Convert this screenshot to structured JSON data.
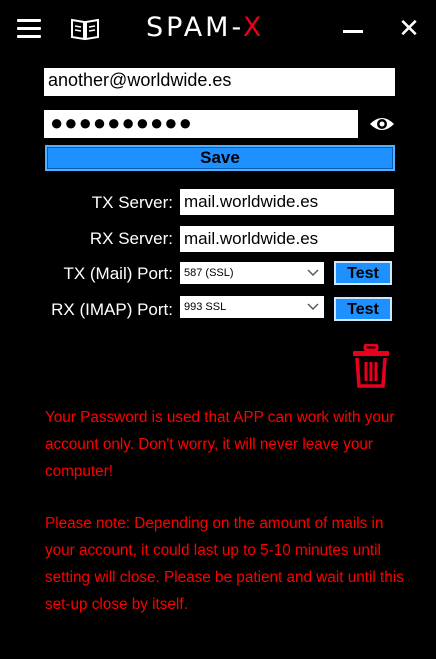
{
  "titlebar": {
    "title_main": "SPAM-",
    "title_accent": "X",
    "close_glyph": "✕"
  },
  "account": {
    "email": "another@worldwide.es",
    "password_masked": "●●●●●●●●●●",
    "save_label": "Save"
  },
  "servers": {
    "tx_label": "TX Server:",
    "tx_value": "mail.worldwide.es",
    "rx_label": "RX Server:",
    "rx_value": "mail.worldwide.es",
    "tx_port_label": "TX (Mail) Port:",
    "tx_port_value": "587 (SSL)",
    "rx_port_label": "RX (IMAP) Port:",
    "rx_port_value": "993 SSL",
    "test_label": "Test"
  },
  "notes": {
    "password_note": "Your Password is used that APP can work with your account only. Don't worry, it will never leave your computer!",
    "duration_note": "Please note: Depending on the amount of mails in your account, it could last up to 5-10 minutes until setting will close. Please be patient and wait until this set-up close by itself."
  },
  "colors": {
    "accent_red": "#e8001c",
    "button_blue": "#1e90ff",
    "text_red": "#ff0000"
  },
  "icons": [
    "menu-icon",
    "book-icon",
    "minimize-icon",
    "close-icon",
    "eye-icon",
    "chevron-down-icon",
    "trash-icon"
  ]
}
